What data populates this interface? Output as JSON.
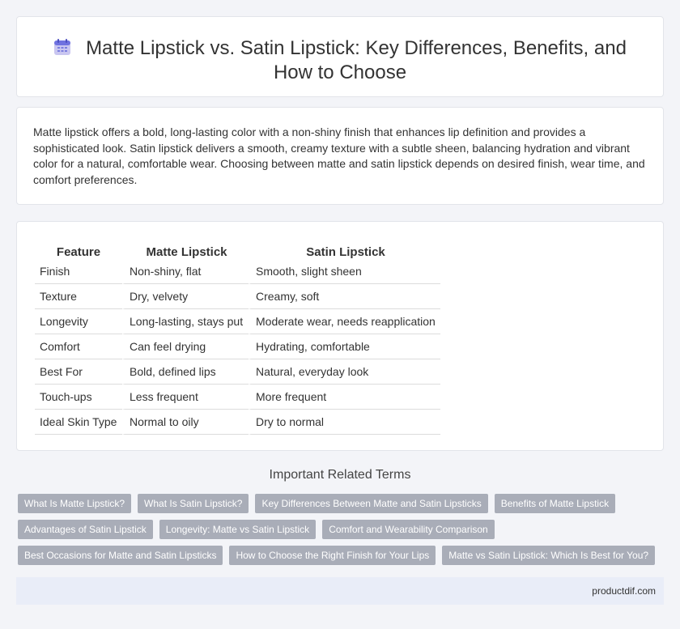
{
  "header": {
    "title": "Matte Lipstick vs. Satin Lipstick: Key Differences, Benefits, and How to Choose",
    "icon": "calendar-icon"
  },
  "intro": {
    "text": "Matte lipstick offers a bold, long-lasting color with a non-shiny finish that enhances lip definition and provides a sophisticated look. Satin lipstick delivers a smooth, creamy texture with a subtle sheen, balancing hydration and vibrant color for a natural, comfortable wear. Choosing between matte and satin lipstick depends on desired finish, wear time, and comfort preferences."
  },
  "table": {
    "headers": [
      "Feature",
      "Matte Lipstick",
      "Satin Lipstick"
    ],
    "rows": [
      [
        "Finish",
        "Non-shiny, flat",
        "Smooth, slight sheen"
      ],
      [
        "Texture",
        "Dry, velvety",
        "Creamy, soft"
      ],
      [
        "Longevity",
        "Long-lasting, stays put",
        "Moderate wear, needs reapplication"
      ],
      [
        "Comfort",
        "Can feel drying",
        "Hydrating, comfortable"
      ],
      [
        "Best For",
        "Bold, defined lips",
        "Natural, everyday look"
      ],
      [
        "Touch-ups",
        "Less frequent",
        "More frequent"
      ],
      [
        "Ideal Skin Type",
        "Normal to oily",
        "Dry to normal"
      ]
    ]
  },
  "related": {
    "title": "Important Related Terms",
    "rows": [
      [
        "What Is Matte Lipstick?",
        "What Is Satin Lipstick?",
        "Key Differences Between Matte and Satin Lipsticks",
        "Benefits of Matte Lipstick"
      ],
      [
        "Advantages of Satin Lipstick",
        "Longevity: Matte vs Satin Lipstick",
        "Comfort and Wearability Comparison"
      ],
      [
        "Best Occasions for Matte and Satin Lipsticks",
        "How to Choose the Right Finish for Your Lips",
        "Matte vs Satin Lipstick: Which Is Best for You?"
      ]
    ]
  },
  "footer": {
    "site": "productdif.com"
  },
  "colors": {
    "tag_bg": "#a9adb8",
    "footer_bg": "#e9edf8",
    "page_bg": "#f3f4f8"
  }
}
